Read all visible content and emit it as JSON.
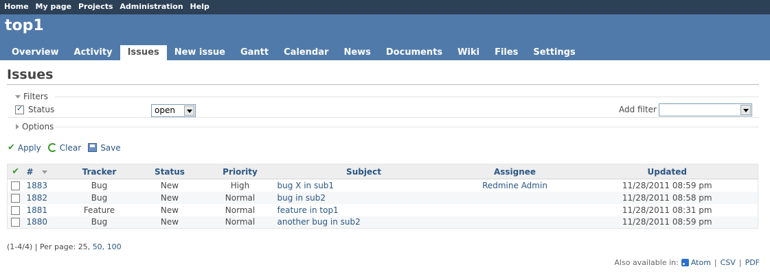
{
  "top_menu": [
    "Home",
    "My page",
    "Projects",
    "Administration",
    "Help"
  ],
  "project_title": "top1",
  "tabs": [
    {
      "label": "Overview"
    },
    {
      "label": "Activity"
    },
    {
      "label": "Issues",
      "selected": true
    },
    {
      "label": "New issue"
    },
    {
      "label": "Gantt"
    },
    {
      "label": "Calendar"
    },
    {
      "label": "News"
    },
    {
      "label": "Documents"
    },
    {
      "label": "Wiki"
    },
    {
      "label": "Files"
    },
    {
      "label": "Settings"
    }
  ],
  "page_title": "Issues",
  "filters": {
    "legend": "Filters",
    "status_label": "Status",
    "status_checked": true,
    "status_value": "open",
    "add_filter_label": "Add filter",
    "add_filter_value": ""
  },
  "options_legend": "Options",
  "actions": {
    "apply": "Apply",
    "clear": "Clear",
    "save": "Save"
  },
  "table": {
    "headers": {
      "id": "#",
      "tracker": "Tracker",
      "status": "Status",
      "priority": "Priority",
      "subject": "Subject",
      "assignee": "Assignee",
      "updated": "Updated"
    },
    "rows": [
      {
        "id": "1883",
        "tracker": "Bug",
        "status": "New",
        "priority": "High",
        "subject": "bug X in sub1",
        "assignee": "Redmine Admin",
        "updated": "11/28/2011 08:59 pm"
      },
      {
        "id": "1882",
        "tracker": "Bug",
        "status": "New",
        "priority": "Normal",
        "subject": "bug in sub2",
        "assignee": "",
        "updated": "11/28/2011 08:58 pm"
      },
      {
        "id": "1881",
        "tracker": "Feature",
        "status": "New",
        "priority": "Normal",
        "subject": "feature in top1",
        "assignee": "",
        "updated": "11/28/2011 08:31 pm"
      },
      {
        "id": "1880",
        "tracker": "Bug",
        "status": "New",
        "priority": "Normal",
        "subject": "another bug in sub2",
        "assignee": "",
        "updated": "11/28/2011 08:59 pm"
      }
    ]
  },
  "pagination": {
    "count": "(1-4/4)",
    "per_page_label": "| Per page:",
    "current": "25,",
    "opt1": "50,",
    "opt2": "100"
  },
  "other_formats": {
    "label": "Also available in:",
    "atom": "Atom",
    "sep1": "|",
    "csv": "CSV",
    "sep2": "|",
    "pdf": "PDF"
  }
}
